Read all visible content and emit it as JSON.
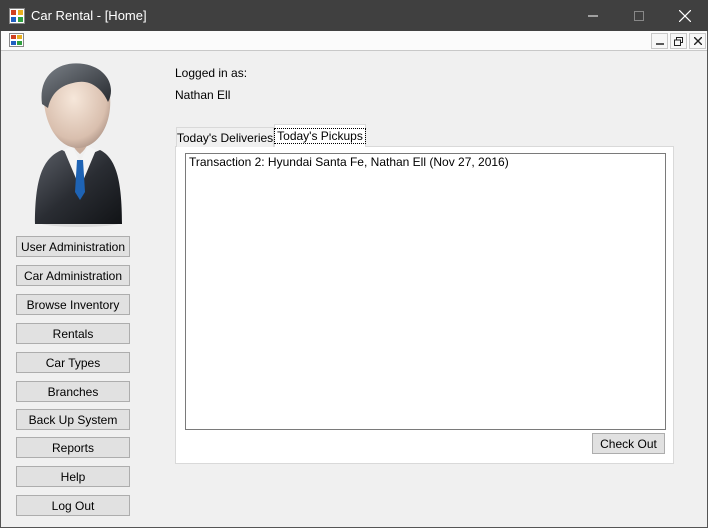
{
  "window": {
    "title": "Car Rental - [Home]",
    "minimize_glyph": "—",
    "maximize_glyph": "☐",
    "close_glyph": "✕"
  },
  "mdi": {
    "minimize_glyph": "‗",
    "restore_glyph": "🗗",
    "close_glyph": "✕"
  },
  "user": {
    "logged_in_label": "Logged in as:",
    "name": "Nathan Ell"
  },
  "sidebar": {
    "items": [
      {
        "label": "User Administration"
      },
      {
        "label": "Car Administration"
      },
      {
        "label": "Browse Inventory"
      },
      {
        "label": "Rentals"
      },
      {
        "label": "Car Types"
      },
      {
        "label": "Branches"
      },
      {
        "label": "Back Up System"
      },
      {
        "label": "Reports"
      },
      {
        "label": "Help"
      },
      {
        "label": "Log Out"
      }
    ]
  },
  "tabs": [
    {
      "label": "Today's Deliveries",
      "active": false
    },
    {
      "label": "Today's Pickups",
      "active": true
    }
  ],
  "pickups": {
    "items": [
      {
        "text": "Transaction 2: Hyundai Santa Fe, Nathan Ell (Nov 27, 2016)"
      }
    ],
    "check_out_label": "Check Out"
  },
  "icons": {
    "app": "app-window-icon",
    "avatar": "businessman-avatar"
  }
}
